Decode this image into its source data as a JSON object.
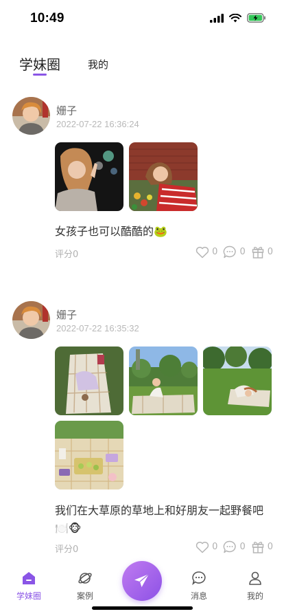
{
  "status_bar": {
    "time": "10:49"
  },
  "tabs": [
    {
      "label": "学妹圈",
      "active": true
    },
    {
      "label": "我的",
      "active": false
    }
  ],
  "accent_color": "#8a55e6",
  "posts": [
    {
      "author": "姗子",
      "time": "2022-07-22 16:36:24",
      "photo_count": 2,
      "caption": "女孩子也可以酷酷的🐸",
      "rating": "评分0",
      "likes": "0",
      "comments": "0",
      "gifts": "0"
    },
    {
      "author": "姗子",
      "time": "2022-07-22 16:35:32",
      "photo_count": 4,
      "caption": "我们在大草原的草地上和好朋友一起野餐吧🍽️🐵",
      "rating": "评分0",
      "likes": "0",
      "comments": "0",
      "gifts": "0"
    }
  ],
  "bottom_nav": [
    {
      "label": "学妹圈",
      "icon": "home-icon",
      "active": true
    },
    {
      "label": "案例",
      "icon": "planet-icon",
      "active": false
    },
    {
      "label": "",
      "icon": "send-icon",
      "active": false
    },
    {
      "label": "消息",
      "icon": "message-icon",
      "active": false
    },
    {
      "label": "我的",
      "icon": "person-icon",
      "active": false
    }
  ]
}
